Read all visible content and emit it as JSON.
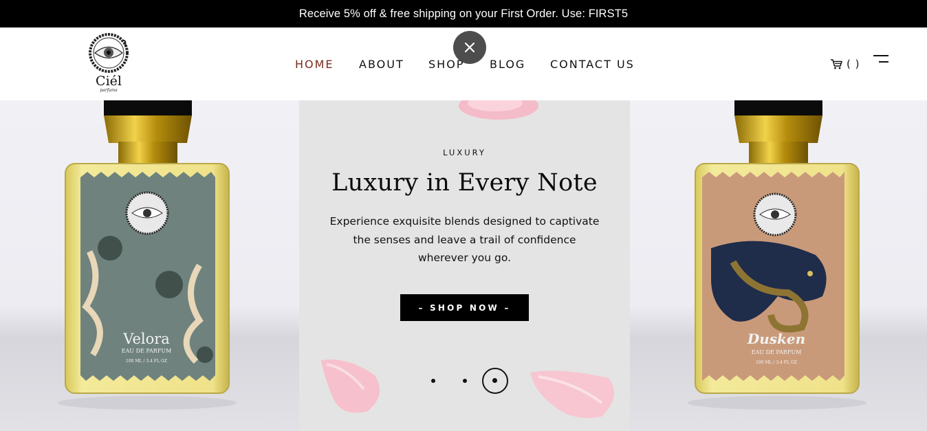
{
  "announcement": {
    "text": "Receive 5% off & free shipping on your First Order. Use: FIRST5"
  },
  "brand": {
    "name": "Ciél",
    "sub": "parfums"
  },
  "nav": {
    "items": [
      {
        "label": "HOME",
        "active": true
      },
      {
        "label": "ABOUT",
        "active": false
      },
      {
        "label": "SHOP",
        "active": false
      },
      {
        "label": "BLOG",
        "active": false
      },
      {
        "label": "CONTACT US",
        "active": false
      }
    ]
  },
  "cart": {
    "count": "( )",
    "icon": "cart-icon"
  },
  "hero": {
    "eyebrow": "LUXURY",
    "title": "Luxury in Every Note",
    "description_lines": [
      "Experience exquisite blends designed to captivate",
      "the senses and leave a trail of confidence",
      "wherever you go."
    ],
    "cta": "– SHOP NOW –",
    "slides": 3,
    "active_slide": 3
  },
  "products": {
    "left": {
      "name": "Velora",
      "type": "EAU DE PARFUM",
      "size": "100 ML / 3.4 FL OZ",
      "label_color": "#6f827d"
    },
    "right": {
      "name": "Dusken",
      "type": "EAU DE PARFUM",
      "size": "100 ML / 3.4 FL OZ",
      "label_color": "#c99a7a"
    }
  },
  "colors": {
    "active_nav": "#7a2a1d",
    "announce_bg": "#000000",
    "bottle_glass": "#e8d56a",
    "cap_gold": "#c9a416"
  }
}
